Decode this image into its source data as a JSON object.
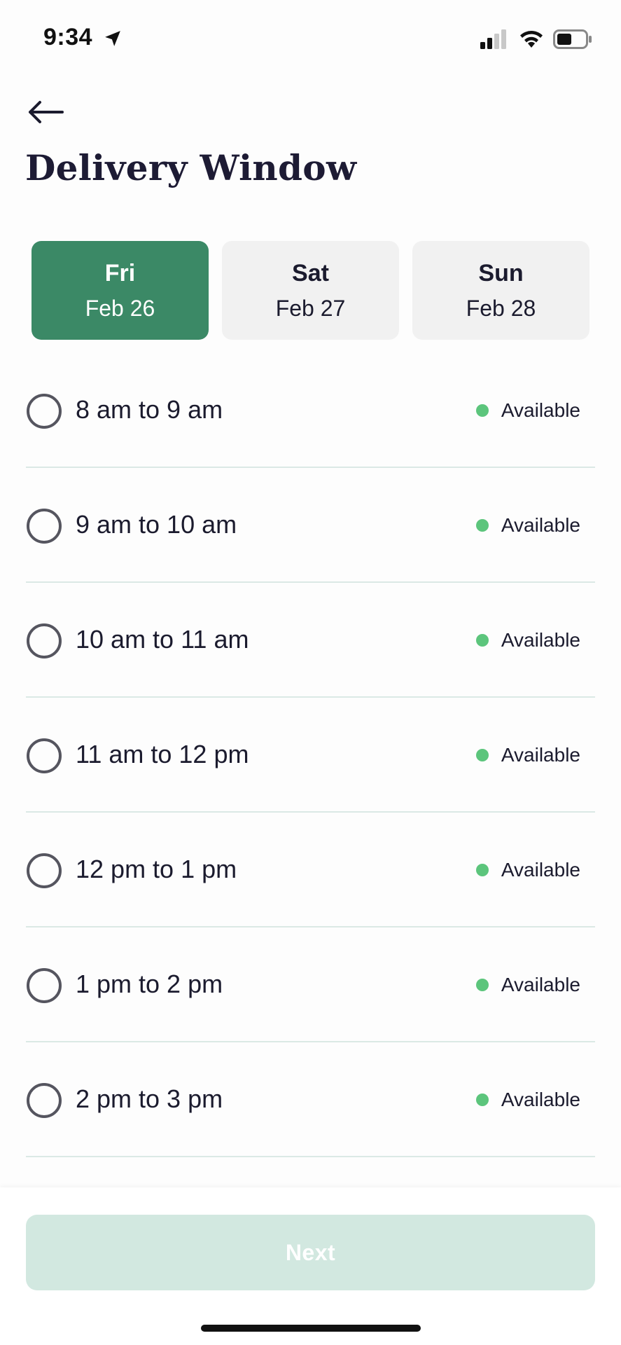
{
  "status_bar": {
    "time": "9:34",
    "icons": [
      "location-arrow-icon",
      "signal-icon",
      "wifi-icon",
      "battery-icon"
    ]
  },
  "header": {
    "back_icon": "arrow-left-icon",
    "title": "Delivery Window"
  },
  "date_tabs": [
    {
      "day": "Fri",
      "date": "Feb 26",
      "selected": true
    },
    {
      "day": "Sat",
      "date": "Feb 27",
      "selected": false
    },
    {
      "day": "Sun",
      "date": "Feb 28",
      "selected": false
    }
  ],
  "time_slots": [
    {
      "label": "8 am to 9 am",
      "status": "Available"
    },
    {
      "label": "9 am to 10 am",
      "status": "Available"
    },
    {
      "label": "10 am to 11 am",
      "status": "Available"
    },
    {
      "label": "11 am to 12 pm",
      "status": "Available"
    },
    {
      "label": "12 pm to 1 pm",
      "status": "Available"
    },
    {
      "label": "1 pm to 2 pm",
      "status": "Available"
    },
    {
      "label": "2 pm to 3 pm",
      "status": "Available"
    }
  ],
  "footer": {
    "next_label": "Next"
  },
  "colors": {
    "accent": "#3b8966",
    "available_dot": "#5cc57c",
    "next_disabled": "#d2e8e0",
    "divider": "#dbe9e5"
  }
}
